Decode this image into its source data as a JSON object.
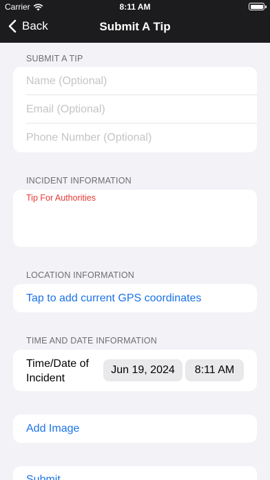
{
  "status_bar": {
    "carrier": "Carrier",
    "time": "8:11 AM",
    "wifi_icon": "wifi-icon",
    "battery_icon": "battery-icon"
  },
  "nav": {
    "back_label": "Back",
    "title": "Submit A Tip"
  },
  "submit_tip_section": {
    "header": "SUBMIT A TIP",
    "name_placeholder": "Name (Optional)",
    "email_placeholder": "Email (Optional)",
    "phone_placeholder": "Phone Number (Optional)"
  },
  "incident_section": {
    "header": "INCIDENT INFORMATION",
    "tip_placeholder": "Tip For Authorities"
  },
  "location_section": {
    "header": "LOCATION INFORMATION",
    "gps_link": "Tap to add current GPS coordinates"
  },
  "time_section": {
    "header": "TIME AND DATE INFORMATION",
    "label": "Time/Date of Incident",
    "date_value": "Jun 19, 2024",
    "time_value": "8:11 AM"
  },
  "actions": {
    "add_image": "Add Image",
    "submit": "Submit"
  },
  "colors": {
    "accent": "#1a73e8",
    "placeholder_red": "#e53935",
    "nav_background": "#1c1c1e",
    "page_background": "#f2f2f7"
  }
}
